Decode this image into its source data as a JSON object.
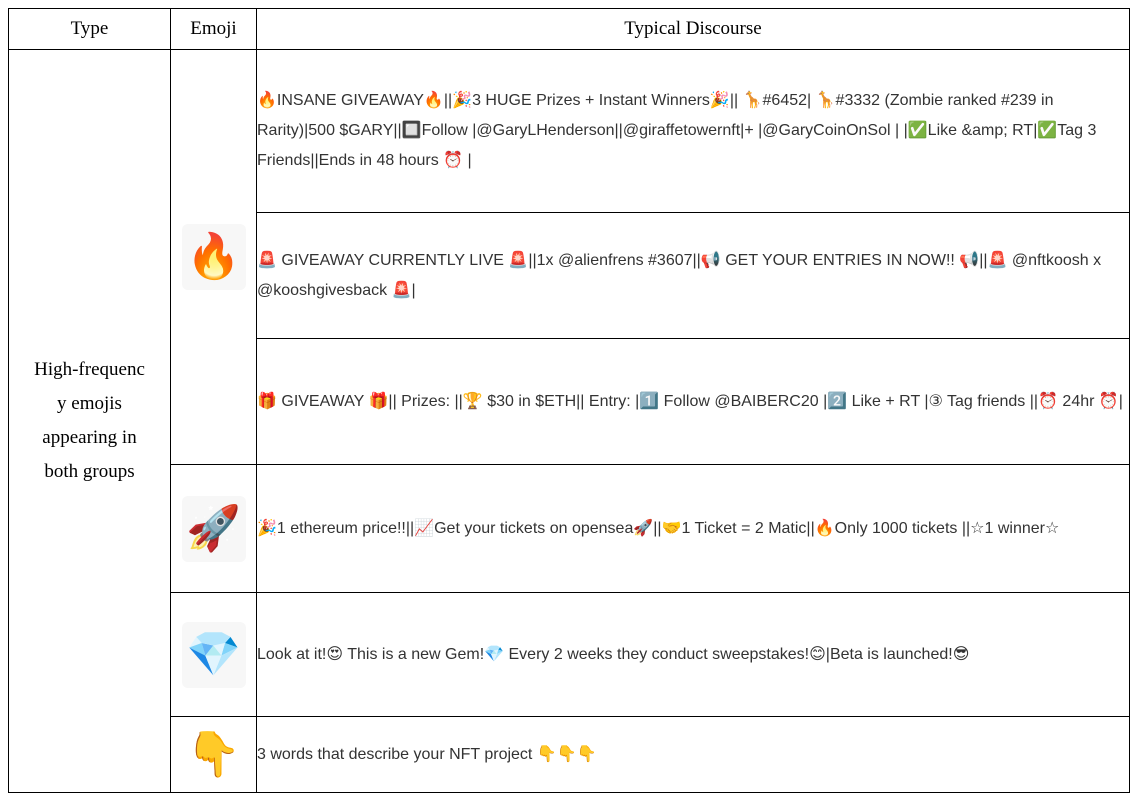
{
  "headers": {
    "type": "Type",
    "emoji": "Emoji",
    "discourse": "Typical Discourse"
  },
  "type_label": "High-frequenc\ny emojis\nappearing in\nboth groups",
  "rows": [
    {
      "icon": "fire-icon",
      "glyph": "🔥",
      "posts": [
        "🔥INSANE GIVEAWAY🔥||🎉3 HUGE Prizes + Instant Winners🎉|| 🦒#6452| 🦒#3332 (Zombie ranked #239 in Rarity)|500 $GARY||🔲Follow |@GaryLHenderson||@giraffetowernft|+ |@GaryCoinOnSol | |✅Like &amp; RT|✅Tag 3 Friends||Ends in 48 hours ⏰ |",
        "🚨 GIVEAWAY CURRENTLY LIVE 🚨||1x @alienfrens #3607||📢 GET YOUR ENTRIES IN NOW!! 📢||🚨 @nftkoosh x @kooshgivesback 🚨|",
        "🎁 GIVEAWAY 🎁|| Prizes: ||🏆 $30 in $ETH|| Entry: |1️⃣ Follow @BAIBERC20 |2️⃣ Like + RT |③ Tag friends ||⏰ 24hr ⏰|"
      ]
    },
    {
      "icon": "rocket-icon",
      "glyph": "🚀",
      "posts": [
        "🎉1 ethereum price!!||📈Get your tickets on opensea🚀||🤝1 Ticket = 2 Matic||🔥Only 1000 tickets ||☆1 winner☆"
      ]
    },
    {
      "icon": "gem-icon",
      "glyph": "💎",
      "posts": [
        "Look at it!😍 This is a new Gem!💎 Every 2 weeks they conduct sweepstakes!😊|Beta is launched!😎"
      ]
    },
    {
      "icon": "pointing-down-icon",
      "glyph": "👇",
      "posts": [
        "3 words that describe your NFT project 👇👇👇"
      ]
    }
  ]
}
